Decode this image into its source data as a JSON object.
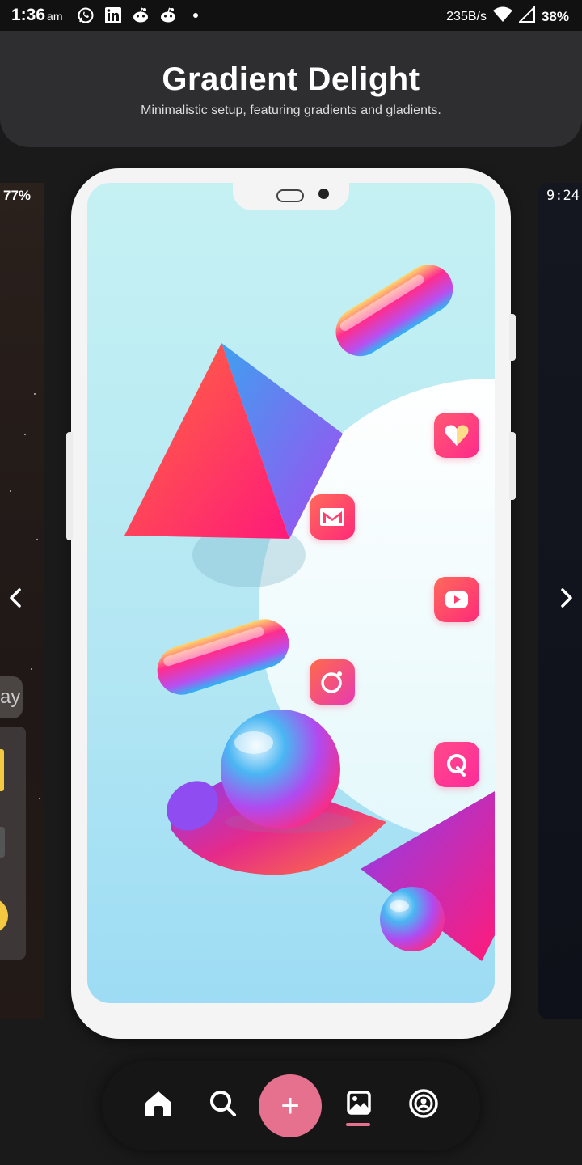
{
  "status_bar": {
    "time": "1:36",
    "ampm": "am",
    "net_speed": "235B/s",
    "battery": "38%",
    "icons": [
      "whatsapp-icon",
      "linkedin-icon",
      "reddit-icon",
      "reddit-icon",
      "dot-icon",
      "wifi-icon",
      "signal-icon"
    ]
  },
  "header": {
    "title": "Gradient Delight",
    "subtitle": "Minimalistic setup, featuring gradients and gladients."
  },
  "left_preview": {
    "battery": "77%",
    "widget_text": "ay"
  },
  "right_preview": {
    "clock": "9:24"
  },
  "preview": {
    "icons": [
      "heart-app-icon",
      "gmail-icon",
      "youtube-icon",
      "instagram-icon",
      "quora-icon"
    ]
  },
  "bottom_nav": {
    "items": [
      "home-icon",
      "search-icon",
      "add-icon",
      "wallpaper-icon",
      "profile-icon"
    ],
    "active": "wallpaper-icon",
    "fab_label": "+",
    "accent": "#e6718e"
  }
}
